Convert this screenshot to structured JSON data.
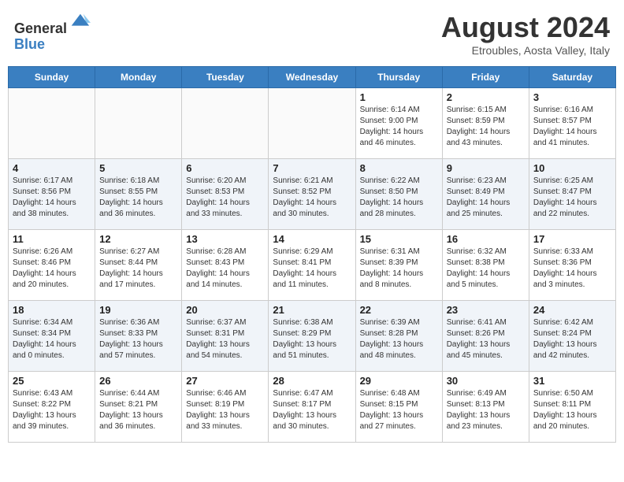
{
  "header": {
    "logo_line1": "General",
    "logo_line2": "Blue",
    "month_year": "August 2024",
    "location": "Etroubles, Aosta Valley, Italy"
  },
  "days_of_week": [
    "Sunday",
    "Monday",
    "Tuesday",
    "Wednesday",
    "Thursday",
    "Friday",
    "Saturday"
  ],
  "weeks": [
    [
      {
        "day": "",
        "info": ""
      },
      {
        "day": "",
        "info": ""
      },
      {
        "day": "",
        "info": ""
      },
      {
        "day": "",
        "info": ""
      },
      {
        "day": "1",
        "info": "Sunrise: 6:14 AM\nSunset: 9:00 PM\nDaylight: 14 hours\nand 46 minutes."
      },
      {
        "day": "2",
        "info": "Sunrise: 6:15 AM\nSunset: 8:59 PM\nDaylight: 14 hours\nand 43 minutes."
      },
      {
        "day": "3",
        "info": "Sunrise: 6:16 AM\nSunset: 8:57 PM\nDaylight: 14 hours\nand 41 minutes."
      }
    ],
    [
      {
        "day": "4",
        "info": "Sunrise: 6:17 AM\nSunset: 8:56 PM\nDaylight: 14 hours\nand 38 minutes."
      },
      {
        "day": "5",
        "info": "Sunrise: 6:18 AM\nSunset: 8:55 PM\nDaylight: 14 hours\nand 36 minutes."
      },
      {
        "day": "6",
        "info": "Sunrise: 6:20 AM\nSunset: 8:53 PM\nDaylight: 14 hours\nand 33 minutes."
      },
      {
        "day": "7",
        "info": "Sunrise: 6:21 AM\nSunset: 8:52 PM\nDaylight: 14 hours\nand 30 minutes."
      },
      {
        "day": "8",
        "info": "Sunrise: 6:22 AM\nSunset: 8:50 PM\nDaylight: 14 hours\nand 28 minutes."
      },
      {
        "day": "9",
        "info": "Sunrise: 6:23 AM\nSunset: 8:49 PM\nDaylight: 14 hours\nand 25 minutes."
      },
      {
        "day": "10",
        "info": "Sunrise: 6:25 AM\nSunset: 8:47 PM\nDaylight: 14 hours\nand 22 minutes."
      }
    ],
    [
      {
        "day": "11",
        "info": "Sunrise: 6:26 AM\nSunset: 8:46 PM\nDaylight: 14 hours\nand 20 minutes."
      },
      {
        "day": "12",
        "info": "Sunrise: 6:27 AM\nSunset: 8:44 PM\nDaylight: 14 hours\nand 17 minutes."
      },
      {
        "day": "13",
        "info": "Sunrise: 6:28 AM\nSunset: 8:43 PM\nDaylight: 14 hours\nand 14 minutes."
      },
      {
        "day": "14",
        "info": "Sunrise: 6:29 AM\nSunset: 8:41 PM\nDaylight: 14 hours\nand 11 minutes."
      },
      {
        "day": "15",
        "info": "Sunrise: 6:31 AM\nSunset: 8:39 PM\nDaylight: 14 hours\nand 8 minutes."
      },
      {
        "day": "16",
        "info": "Sunrise: 6:32 AM\nSunset: 8:38 PM\nDaylight: 14 hours\nand 5 minutes."
      },
      {
        "day": "17",
        "info": "Sunrise: 6:33 AM\nSunset: 8:36 PM\nDaylight: 14 hours\nand 3 minutes."
      }
    ],
    [
      {
        "day": "18",
        "info": "Sunrise: 6:34 AM\nSunset: 8:34 PM\nDaylight: 14 hours\nand 0 minutes."
      },
      {
        "day": "19",
        "info": "Sunrise: 6:36 AM\nSunset: 8:33 PM\nDaylight: 13 hours\nand 57 minutes."
      },
      {
        "day": "20",
        "info": "Sunrise: 6:37 AM\nSunset: 8:31 PM\nDaylight: 13 hours\nand 54 minutes."
      },
      {
        "day": "21",
        "info": "Sunrise: 6:38 AM\nSunset: 8:29 PM\nDaylight: 13 hours\nand 51 minutes."
      },
      {
        "day": "22",
        "info": "Sunrise: 6:39 AM\nSunset: 8:28 PM\nDaylight: 13 hours\nand 48 minutes."
      },
      {
        "day": "23",
        "info": "Sunrise: 6:41 AM\nSunset: 8:26 PM\nDaylight: 13 hours\nand 45 minutes."
      },
      {
        "day": "24",
        "info": "Sunrise: 6:42 AM\nSunset: 8:24 PM\nDaylight: 13 hours\nand 42 minutes."
      }
    ],
    [
      {
        "day": "25",
        "info": "Sunrise: 6:43 AM\nSunset: 8:22 PM\nDaylight: 13 hours\nand 39 minutes."
      },
      {
        "day": "26",
        "info": "Sunrise: 6:44 AM\nSunset: 8:21 PM\nDaylight: 13 hours\nand 36 minutes."
      },
      {
        "day": "27",
        "info": "Sunrise: 6:46 AM\nSunset: 8:19 PM\nDaylight: 13 hours\nand 33 minutes."
      },
      {
        "day": "28",
        "info": "Sunrise: 6:47 AM\nSunset: 8:17 PM\nDaylight: 13 hours\nand 30 minutes."
      },
      {
        "day": "29",
        "info": "Sunrise: 6:48 AM\nSunset: 8:15 PM\nDaylight: 13 hours\nand 27 minutes."
      },
      {
        "day": "30",
        "info": "Sunrise: 6:49 AM\nSunset: 8:13 PM\nDaylight: 13 hours\nand 23 minutes."
      },
      {
        "day": "31",
        "info": "Sunrise: 6:50 AM\nSunset: 8:11 PM\nDaylight: 13 hours\nand 20 minutes."
      }
    ]
  ]
}
